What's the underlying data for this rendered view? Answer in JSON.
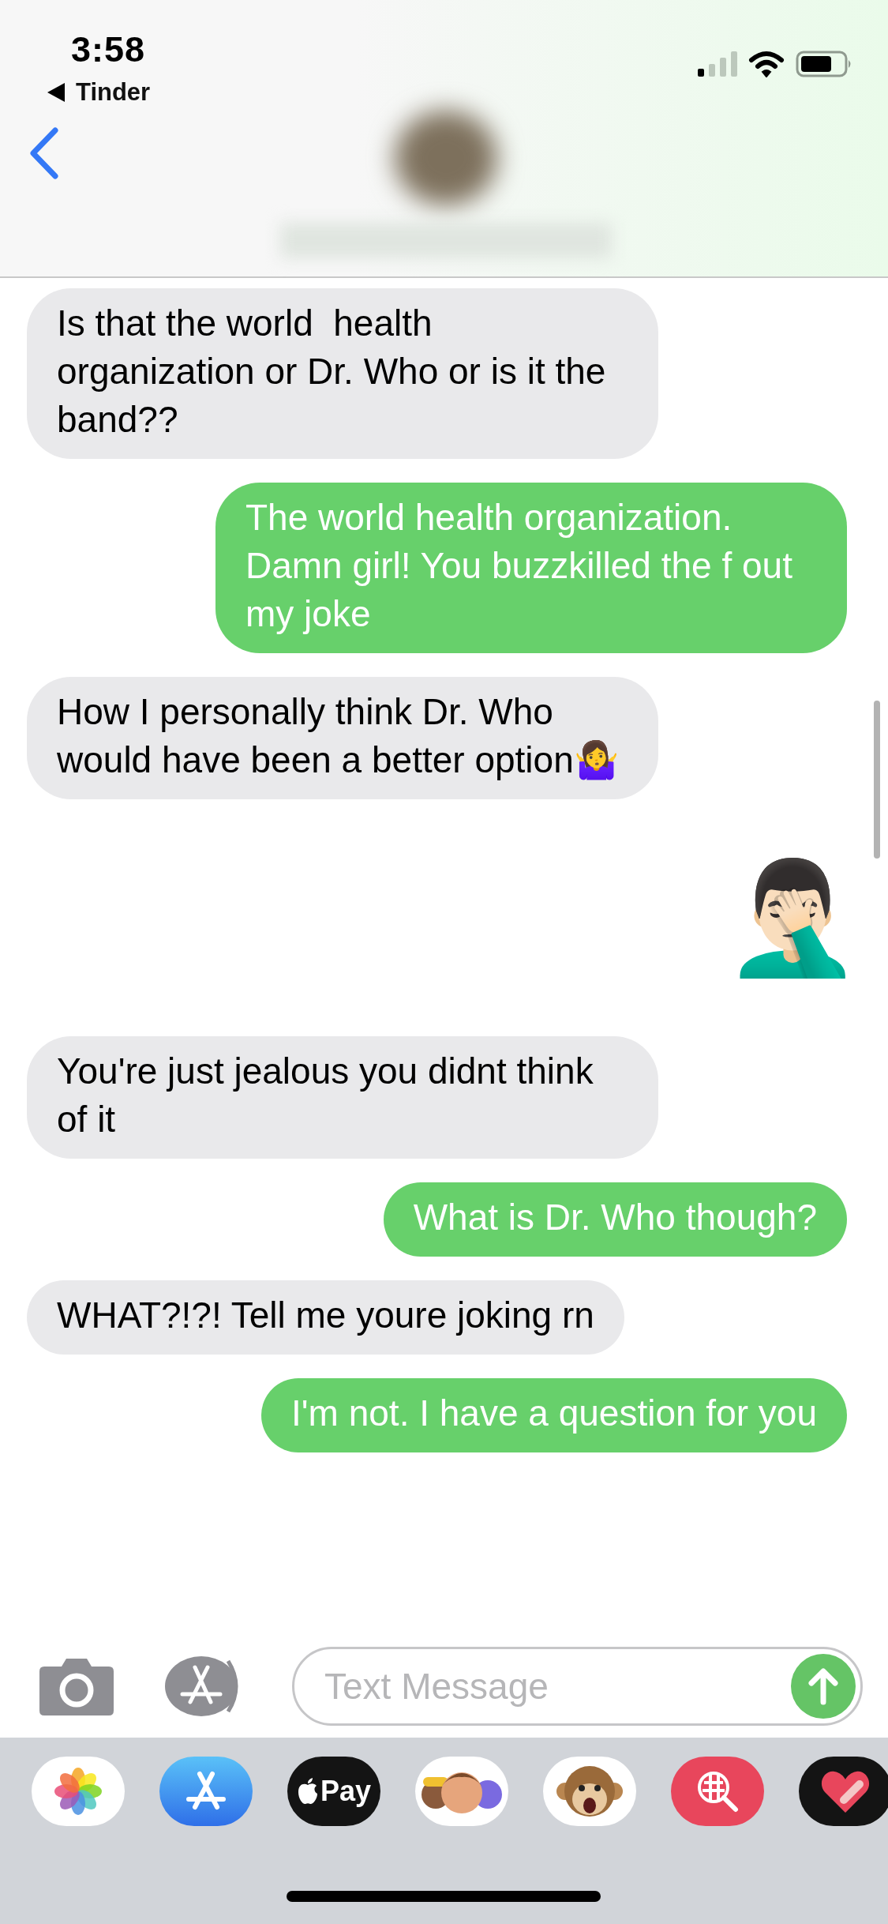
{
  "status_bar": {
    "time": "3:58",
    "back_app": "Tinder"
  },
  "messages": [
    {
      "kind": "received",
      "text": "Is that the world  health organization or Dr. Who or is it the band??"
    },
    {
      "kind": "sent",
      "text": "The world health organization. Damn girl! You buzzkilled the f out my joke"
    },
    {
      "kind": "received",
      "text": "How I personally think Dr. Who would have been a better option🤷‍♀️"
    },
    {
      "kind": "emoji",
      "text": "🤦🏻‍♂️"
    },
    {
      "kind": "received",
      "text": "You're just jealous you didnt think of it"
    },
    {
      "kind": "sent",
      "text": "What is Dr. Who though?"
    },
    {
      "kind": "received",
      "text": "WHAT?!?! Tell me youre joking rn"
    },
    {
      "kind": "sent",
      "text": "I'm not. I have a question for you"
    }
  ],
  "composer": {
    "placeholder": "Text Message"
  },
  "app_drawer": [
    {
      "kind": "photos"
    },
    {
      "kind": "appstore"
    },
    {
      "kind": "applepay",
      "label": "Pay"
    },
    {
      "kind": "memoji"
    },
    {
      "kind": "animoji"
    },
    {
      "kind": "search"
    },
    {
      "kind": "heart"
    }
  ]
}
